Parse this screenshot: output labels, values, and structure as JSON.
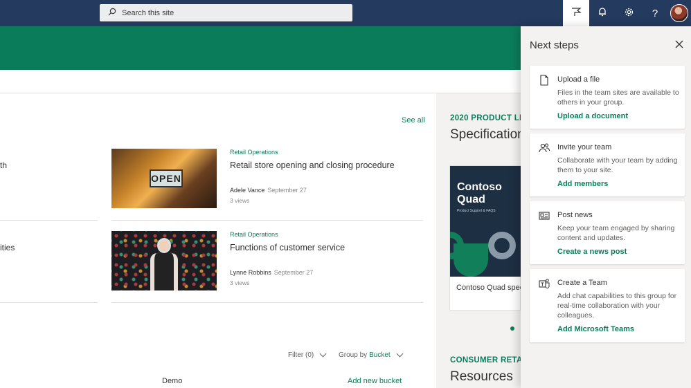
{
  "suitebar": {
    "search_placeholder": "Search this site"
  },
  "main": {
    "see_all": "See all",
    "cut_texts": [
      "th",
      "ities"
    ],
    "news": [
      {
        "category": "Retail Operations",
        "title": "Retail store opening and closing procedure",
        "author": "Adele Vance",
        "date": "September 27",
        "views": "3 views",
        "sign_text": "OPEN"
      },
      {
        "category": "Retail Operations",
        "title": "Functions of customer service",
        "author": "Lynne Robbins",
        "date": "September 27",
        "views": "3 views"
      }
    ],
    "toolbar": {
      "filter_label": "Filter (0)",
      "group_by_label": "Group by",
      "group_by_value": "Bucket"
    },
    "bucket": {
      "name": "Demo",
      "add_label": "Add new bucket"
    }
  },
  "rightcol": {
    "eyebrow1": "2020 PRODUCT LI",
    "heading1": "Specification",
    "card": {
      "title_line1": "Contoso",
      "title_line2": "Quad",
      "subtitle": "Product Support & FAQS",
      "caption": "Contoso Quad spec"
    },
    "eyebrow2": "CONSUMER RETA",
    "heading2": "Resources"
  },
  "panel": {
    "title": "Next steps",
    "steps": [
      {
        "icon": "document-icon",
        "title": "Upload a file",
        "description": "Files in the team sites are available to others in your group.",
        "link": "Upload a document"
      },
      {
        "icon": "people-icon",
        "title": "Invite your team",
        "description": "Collaborate with your team by adding them to your site.",
        "link": "Add members"
      },
      {
        "icon": "news-icon",
        "title": "Post news",
        "description": "Keep your team engaged by sharing content and updates.",
        "link": "Create a news post"
      },
      {
        "icon": "teams-icon",
        "title": "Create a Team",
        "description": "Add chat capabilities to this group for real-time collaboration with your colleagues.",
        "link": "Add Microsoft Teams"
      }
    ]
  },
  "colors": {
    "brand": "#0b7c5a",
    "suitebar": "#243a5e",
    "panel_bg": "#f3f2f1"
  }
}
